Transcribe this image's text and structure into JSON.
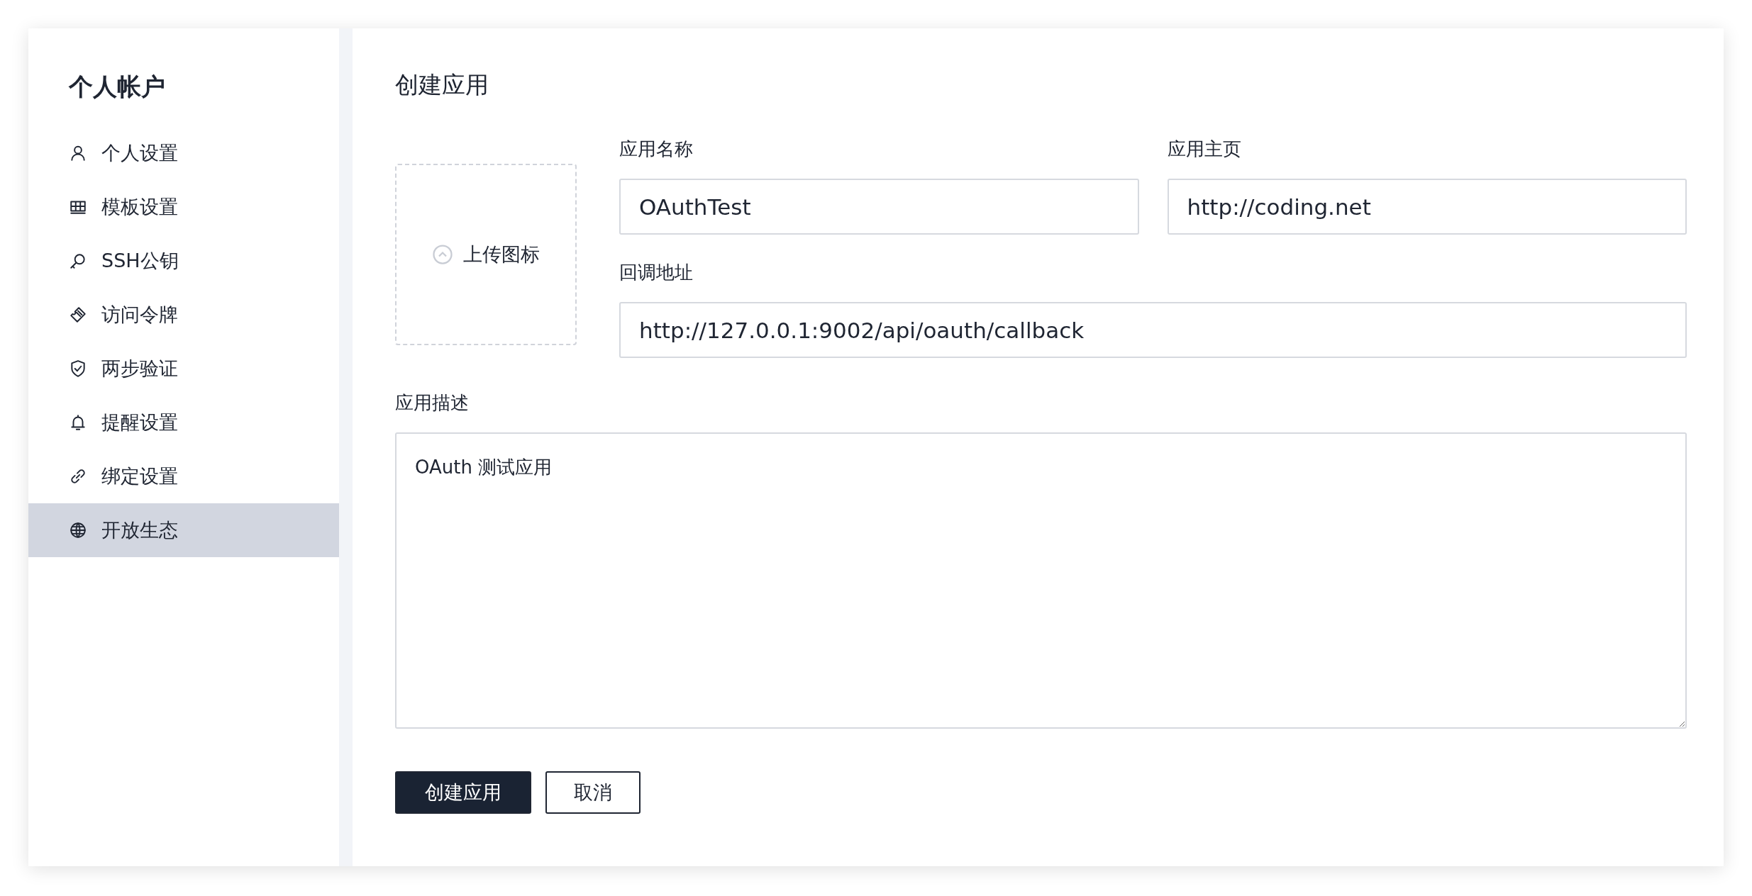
{
  "sidebar": {
    "title": "个人帐户",
    "items": [
      {
        "label": "个人设置",
        "selected": false
      },
      {
        "label": "模板设置",
        "selected": false
      },
      {
        "label": "SSH公钥",
        "selected": false
      },
      {
        "label": "访问令牌",
        "selected": false
      },
      {
        "label": "两步验证",
        "selected": false
      },
      {
        "label": "提醒设置",
        "selected": false
      },
      {
        "label": "绑定设置",
        "selected": false
      },
      {
        "label": "开放生态",
        "selected": true
      }
    ]
  },
  "main": {
    "title": "创建应用",
    "upload": {
      "label": "上传图标"
    },
    "fields": [
      {
        "label": "应用名称",
        "value": "OAuthTest"
      },
      {
        "label": "应用主页",
        "value": "http://coding.net"
      },
      {
        "label": "回调地址",
        "value": "http://127.0.0.1:9002/api/oauth/callback"
      }
    ],
    "description": {
      "label": "应用描述",
      "value": "OAuth 测试应用"
    },
    "buttons": [
      {
        "label": "创建应用",
        "kind": "primary"
      },
      {
        "label": "取消",
        "kind": "secondary"
      }
    ]
  }
}
